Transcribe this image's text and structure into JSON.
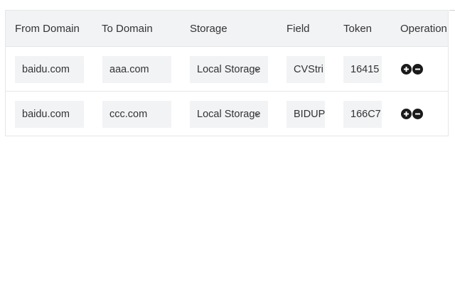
{
  "table": {
    "headers": {
      "from_domain": "From Domain",
      "to_domain": "To Domain",
      "storage": "Storage",
      "field": "Field",
      "token": "Token",
      "operation": "Operation"
    },
    "rows": [
      {
        "from_domain": "baidu.com",
        "to_domain": "aaa.com",
        "storage": "Local Storage",
        "field": "CVStri",
        "token": "16415"
      },
      {
        "from_domain": "baidu.com",
        "to_domain": "ccc.com",
        "storage": "Local Storage",
        "field": "BIDUP",
        "token": "166C7"
      }
    ],
    "icons": {
      "add": "plus-circle-icon",
      "remove": "minus-circle-icon",
      "dropdown": "chevron-down-icon"
    },
    "colors": {
      "header_bg": "#f2f3f5",
      "input_bg": "#f2f3f5",
      "border": "#e6e6e6",
      "icon": "#1a1a1a"
    }
  }
}
